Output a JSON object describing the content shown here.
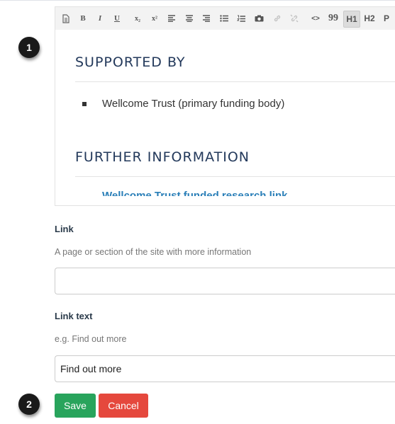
{
  "editor": {
    "toolbar": {
      "bold": "B",
      "italic": "I",
      "underline": "U",
      "subscript": "x₂",
      "superscript": "x²",
      "code": "<>",
      "quote": "99",
      "h1": "H1",
      "h2": "H2",
      "paragraph": "P"
    },
    "content": {
      "heading_supported": "SUPPORTED BY",
      "supported_item": "Wellcome Trust (primary funding body)",
      "heading_further": "FURTHER INFORMATION"
    }
  },
  "form": {
    "link_label": "Link",
    "link_hint": "A page or section of the site with more information",
    "link_value": "",
    "link_text_label": "Link text",
    "link_text_hint": "e.g. Find out more",
    "link_text_value": "Find out more"
  },
  "actions": {
    "save_label": "Save",
    "cancel_label": "Cancel"
  },
  "markers": {
    "step1": "1",
    "step2": "2"
  }
}
